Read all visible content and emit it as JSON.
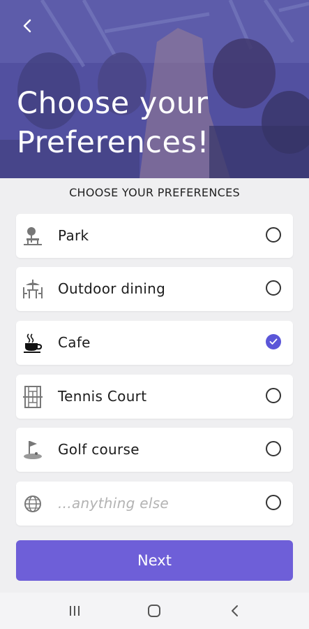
{
  "header": {
    "back_icon": "chevron-left-icon",
    "title": "Choose your Preferences!"
  },
  "section": {
    "label": "CHOOSE YOUR PREFERENCES"
  },
  "preferences": [
    {
      "label": "Park",
      "icon": "park-icon",
      "selected": false
    },
    {
      "label": "Outdoor dining",
      "icon": "outdoor-dining-icon",
      "selected": false
    },
    {
      "label": "Cafe",
      "icon": "coffee-cup-icon",
      "selected": true
    },
    {
      "label": "Tennis Court",
      "icon": "tennis-court-icon",
      "selected": false
    },
    {
      "label": "Golf course",
      "icon": "golf-flag-icon",
      "selected": false
    }
  ],
  "other": {
    "placeholder": "...anything else",
    "icon": "globe-icon",
    "selected": false
  },
  "next_button": {
    "label": "Next"
  },
  "navbar": {
    "recent_icon": "recent-apps-icon",
    "home_icon": "home-icon",
    "back_icon": "back-icon"
  },
  "colors": {
    "accent": "#6e5fd8",
    "radio_selected": "#5b56d8",
    "background": "#efeff1"
  }
}
